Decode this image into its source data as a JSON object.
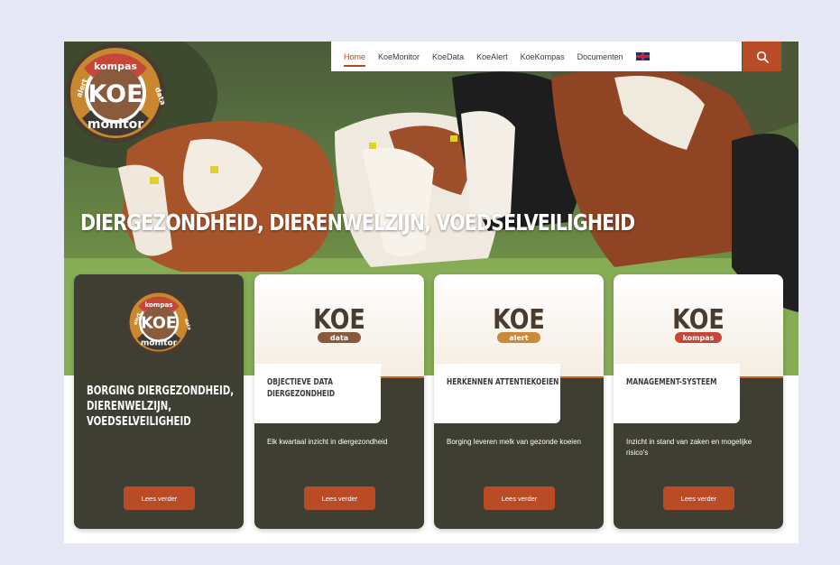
{
  "nav": {
    "items": [
      "Home",
      "KoeMonitor",
      "KoeData",
      "KoeAlert",
      "KoeKompas",
      "Documenten"
    ],
    "active": "Home"
  },
  "logo": {
    "top": "kompas",
    "left": "alert",
    "center": "KOE",
    "right": "data",
    "bottom": "monitor"
  },
  "hero": {
    "headline": "DIERGEZONDHEID, DIERENWELZIJN, VOEDSELVEILIGHEID"
  },
  "cards": [
    {
      "title": "BORGING DIERGEZONDHEID, DIERENWELZIJN, VOEDSELVEILIGHEID",
      "button": "Lees verder"
    },
    {
      "brand": "KOE",
      "badge": "data",
      "tab": "OBJECTIEVE DATA DIERGEZONDHEID",
      "desc": "Elk kwartaal inzicht in diergezondheid",
      "button": "Lees verder"
    },
    {
      "brand": "KOE",
      "badge": "alert",
      "tab": "HERKENNEN ATTENTIEKOEIEN",
      "desc": "Borging leveren melk van gezonde koeien",
      "button": "Lees verder"
    },
    {
      "brand": "KOE",
      "badge": "kompas",
      "tab": "MANAGEMENT-SYSTEEM",
      "desc": "Inzicht in stand van zaken en mogelijke risico's",
      "button": "Lees verder"
    }
  ],
  "colors": {
    "accent": "#b94c27",
    "dark": "#3f3e33",
    "background": "#e6e8f5",
    "data_badge": "#8a5a3c",
    "alert_badge": "#c98a3a",
    "kompas_badge": "#c4473a"
  },
  "icons": {
    "search": "search-icon",
    "language": "uk-flag-icon"
  }
}
